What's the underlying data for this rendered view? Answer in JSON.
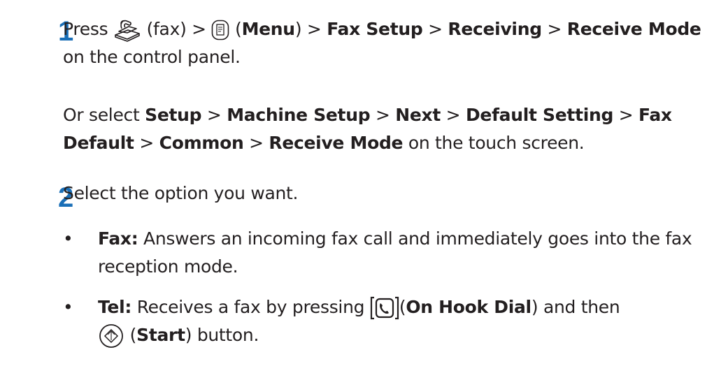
{
  "steps": [
    {
      "number": "1",
      "line1": {
        "t0": "Press ",
        "t1": " (fax) > ",
        "t2": " (",
        "menu": "Menu",
        "t3": ") > ",
        "fax_setup": "Fax Setup",
        "t4": " > ",
        "receiving": "Receiving",
        "t5": " > ",
        "receive_mode": "Receive Mode",
        "t6": " on the control panel."
      },
      "line2": {
        "t0": "Or select ",
        "setup": "Setup",
        "t1": " > ",
        "machine_setup": "Machine Setup",
        "t2": " > ",
        "next": "Next",
        "t3": " > ",
        "default_setting": "Default Setting",
        "t4": " > ",
        "fax_default": "Fax Default",
        "t5": " > ",
        "common": "Common",
        "t6": " > ",
        "receive_mode": "Receive Mode",
        "t7": " on the touch screen."
      }
    },
    {
      "number": "2",
      "intro": "Select the option you want.",
      "bullets": [
        {
          "marker": "•",
          "term": "Fax:",
          "text": " Answers an incoming fax call and immediately goes into the fax reception mode."
        },
        {
          "marker": "•",
          "term": "Tel:",
          "t0": " Receives a fax by pressing ",
          "t1": "(",
          "on_hook": "On Hook Dial",
          "t2": ") and then",
          "t3": " (",
          "start": "Start",
          "t4": ") button."
        }
      ]
    }
  ],
  "icons": {
    "fax": "fax-icon",
    "menu": "menu-icon",
    "on_hook": "on-hook-dial-icon",
    "start": "start-icon"
  },
  "colors": {
    "step_number": "#1a6fb7",
    "text": "#231f20"
  }
}
